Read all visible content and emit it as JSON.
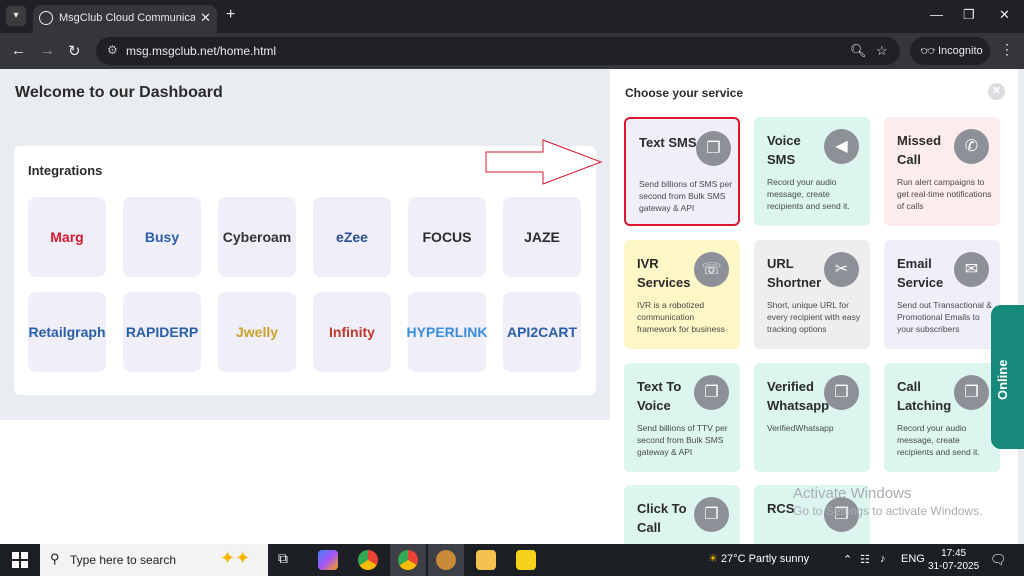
{
  "browser": {
    "tab_title": "MsgClub Cloud Communication",
    "url": "msg.msgclub.net/home.html",
    "incognito_label": "Incognito"
  },
  "page": {
    "welcome": "Welcome to our Dashboard",
    "integrations_title": "Integrations",
    "integrations": [
      {
        "name": "Marg",
        "color": "#d9182d"
      },
      {
        "name": "Busy",
        "color": "#2a5fa9"
      },
      {
        "name": "Cyberoam",
        "color": "#333333"
      },
      {
        "name": "eZee",
        "color": "#2a4f8f"
      },
      {
        "name": "FOCUS",
        "color": "#2b2b2b"
      },
      {
        "name": "JAZE",
        "color": "#2b2b2b"
      },
      {
        "name": "Retailgraph",
        "color": "#2a5fa9"
      },
      {
        "name": "RAPIDERP",
        "color": "#2a5fa9"
      },
      {
        "name": "Jwelly",
        "color": "#c9a227"
      },
      {
        "name": "Infinity",
        "color": "#c0392b"
      },
      {
        "name": "HYPERLINK",
        "color": "#3a8dde"
      },
      {
        "name": "API2CART",
        "color": "#2a5fa9"
      }
    ]
  },
  "panel": {
    "title": "Choose your service",
    "services": [
      {
        "title": "Text SMS",
        "desc": "Send billions of SMS per second from Bulk SMS gateway & API",
        "bg": "#efeef9",
        "icon": "chat-icon",
        "selected": true
      },
      {
        "title": "Voice SMS",
        "desc": "Record your audio message, create recipients and send it.",
        "bg": "#dcf5ee",
        "icon": "megaphone-icon"
      },
      {
        "title": "Missed Call",
        "desc": "Run alert campaigns to get real-time notifications of calls",
        "bg": "#fdecec",
        "icon": "phone-icon"
      },
      {
        "title": "IVR Services",
        "desc": "IVR is a robotized communication framework for business",
        "bg": "#fdf6c6",
        "icon": "ivr-icon"
      },
      {
        "title": "URL Shortner",
        "desc": "Short, unique URL for every recipient with easy tracking options",
        "bg": "#eeeeef",
        "icon": "scissors-icon"
      },
      {
        "title": "Email Service",
        "desc": "Send out Transactional & Promotional Emails to your subscribers",
        "bg": "#efeef9",
        "icon": "mail-icon"
      },
      {
        "title": "Text To Voice",
        "desc": "Send billions of TTV per second from Bulk SMS gateway & API",
        "bg": "#dcf5ee",
        "icon": "chat-icon"
      },
      {
        "title": "Verified Whatsapp",
        "desc": "VerifiedWhatsapp",
        "bg": "#dcf5ee",
        "icon": "chat-icon"
      },
      {
        "title": "Call Latching",
        "desc": "Record your audio message, create recipients and send it.",
        "bg": "#dcf5ee",
        "icon": "chat-icon"
      },
      {
        "title": "Click To Call",
        "desc": "",
        "bg": "#dcf5ee",
        "icon": "chat-icon"
      },
      {
        "title": "RCS",
        "desc": "",
        "bg": "#dcf5ee",
        "icon": "chat-icon"
      }
    ]
  },
  "online_label": "Online",
  "watermark": {
    "line1": "Activate Windows",
    "line2": "Go to Settings to activate Windows."
  },
  "taskbar": {
    "search_placeholder": "Type here to search",
    "temperature": "27°C",
    "weather": "Partly sunny",
    "language": "ENG",
    "time": "17:45",
    "date": "31-07-2025"
  }
}
